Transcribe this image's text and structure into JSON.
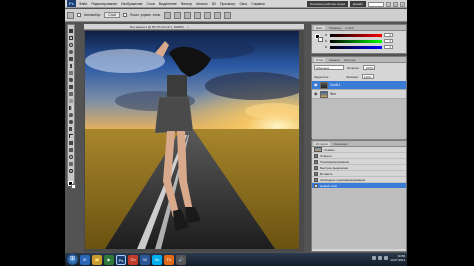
{
  "app": {
    "logo": "Ps",
    "menu": [
      "Файл",
      "Редактирование",
      "Изображение",
      "Слои",
      "Выделение",
      "Фильтр",
      "Анализ",
      "3D",
      "Просмотр",
      "Окно",
      "Справка"
    ],
    "workspace_label": "Основная рабочая среда",
    "workspace_button": "Дизайн",
    "window_buttons": [
      "-",
      "□",
      "×"
    ]
  },
  "options_bar": {
    "checkbox_label": "Автовыбор:",
    "select_value": "Слой",
    "show_controls": "Показ. управл. элем."
  },
  "document": {
    "tab_title": "Без имени-1 @ 66,7% (Слой 1, RGB/8)",
    "close": "×"
  },
  "color_panel": {
    "tabs": [
      "Цвет",
      "Образцы",
      "Стили"
    ],
    "channels": [
      {
        "label": "R",
        "value": "0"
      },
      {
        "label": "G",
        "value": "0"
      },
      {
        "label": "B",
        "value": "0"
      }
    ]
  },
  "layers_panel": {
    "tabs": [
      "Слои",
      "Каналы",
      "Контуры"
    ],
    "blend_mode": "Обычные",
    "opacity_label": "Непрозр.:",
    "opacity_value": "100%",
    "fill_label": "Заливка:",
    "fill_value": "100%",
    "lock_label": "Закрепить:",
    "layers": [
      {
        "name": "Слой 1",
        "selected": true
      },
      {
        "name": "Фон",
        "selected": false
      }
    ]
  },
  "history_panel": {
    "tabs": [
      "История",
      "Операции"
    ],
    "snapshot": "Снимок",
    "items": [
      {
        "label": "Открыть",
        "selected": false
      },
      {
        "label": "Трансформирование",
        "selected": false
      },
      {
        "label": "Быстрое выделение",
        "selected": false
      },
      {
        "label": "Вставить",
        "selected": false
      },
      {
        "label": "Свободное трансформирование",
        "selected": false
      },
      {
        "label": "Новый слой",
        "selected": true
      }
    ]
  },
  "taskbar": {
    "start": "⊞",
    "apps": [
      "IE",
      "📁",
      "▶",
      "Ps",
      "Ch",
      "W",
      "Sk",
      "Fx",
      "🔊"
    ],
    "time": "11:56",
    "date": "14.07.2011"
  },
  "colors": {
    "accent": "#3a7bd5",
    "workspace_bg": "#535353",
    "panel_bg": "#d6d6d6"
  }
}
